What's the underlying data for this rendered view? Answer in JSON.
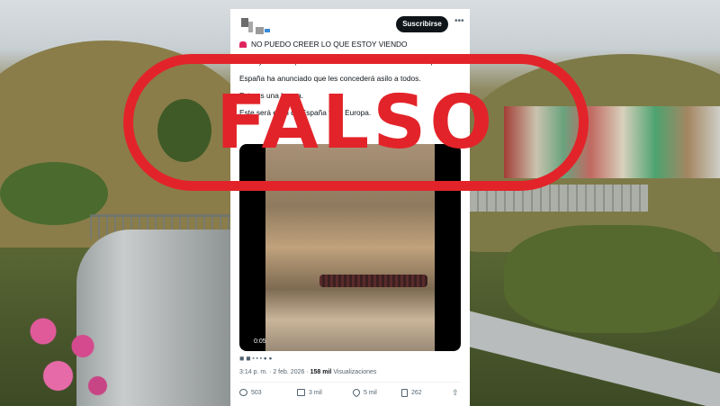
{
  "post": {
    "follow_label": "Suscribirse",
    "lines": [
      "NO PUEDO CREER LO QUE ESTOY VIENDO",
      "Miles y miles de personas marchan desde África hacia España.",
      "España ha anunciado que les concederá asilo a todos.",
      "Esto es una locura.",
      "Este será el fin de España y de Europa."
    ],
    "video_duration": "0:05",
    "timestamp": "3:14 p. m. · 2 feb. 2026 ·",
    "views_count": "158 mil",
    "views_label": "Visualizaciones",
    "actions": {
      "replies": "503",
      "reposts": "3 mil",
      "likes": "5 mil",
      "bookmarks": "262"
    }
  },
  "overlay": {
    "verdict": "FALSO",
    "color": "#e2242a"
  },
  "icons": [
    "siren-icon",
    "more-icon",
    "reply-icon",
    "repost-icon",
    "like-icon",
    "bookmark-icon",
    "share-icon"
  ]
}
